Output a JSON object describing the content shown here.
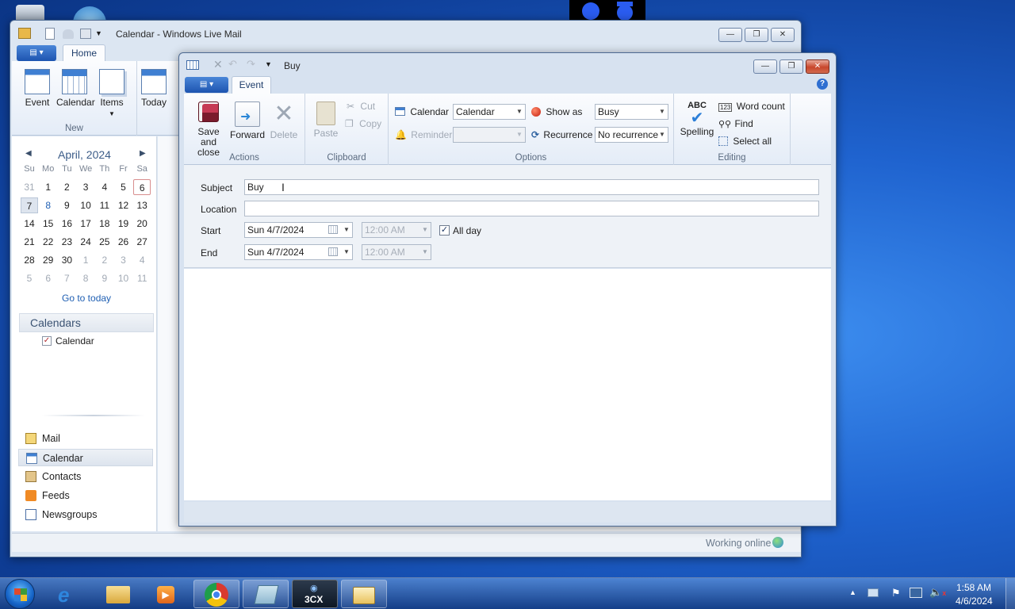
{
  "main_window": {
    "title": "Calendar - Windows Live Mail",
    "tab_home": "Home",
    "new_group": "New",
    "btn_event": "Event",
    "btn_calendar": "Calendar",
    "btn_items": "Items",
    "btn_today": "Today",
    "status": "Working online"
  },
  "mini_calendar": {
    "month": "April, 2024",
    "day_headers": [
      "Su",
      "Mo",
      "Tu",
      "We",
      "Th",
      "Fr",
      "Sa"
    ],
    "weeks": [
      [
        "31",
        "1",
        "2",
        "3",
        "4",
        "5",
        "6"
      ],
      [
        "7",
        "8",
        "9",
        "10",
        "11",
        "12",
        "13"
      ],
      [
        "14",
        "15",
        "16",
        "17",
        "18",
        "19",
        "20"
      ],
      [
        "21",
        "22",
        "23",
        "24",
        "25",
        "26",
        "27"
      ],
      [
        "28",
        "29",
        "30",
        "1",
        "2",
        "3",
        "4"
      ],
      [
        "5",
        "6",
        "7",
        "8",
        "9",
        "10",
        "11"
      ]
    ],
    "go_to_today": "Go to today"
  },
  "calendars_panel": {
    "header": "Calendars",
    "items": [
      "Calendar"
    ]
  },
  "nav": {
    "items": [
      "Mail",
      "Calendar",
      "Contacts",
      "Feeds",
      "Newsgroups"
    ]
  },
  "event_window": {
    "title": "Buy",
    "tab_event": "Event",
    "actions": {
      "save": "Save and close",
      "forward": "Forward",
      "delete": "Delete",
      "group": "Actions"
    },
    "clipboard": {
      "paste": "Paste",
      "cut": "Cut",
      "copy": "Copy",
      "group": "Clipboard"
    },
    "options": {
      "calendar_label": "Calendar",
      "calendar_value": "Calendar",
      "show_as_label": "Show as",
      "show_as_value": "Busy",
      "reminder_label": "Reminder",
      "reminder_value": "",
      "recurrence_label": "Recurrence",
      "recurrence_value": "No recurrence",
      "group": "Options"
    },
    "editing": {
      "spelling": "Spelling",
      "word_count": "Word count",
      "find": "Find",
      "select_all": "Select all",
      "group": "Editing"
    },
    "form": {
      "subject_label": "Subject",
      "subject_value": "Buy",
      "location_label": "Location",
      "location_value": "",
      "start_label": "Start",
      "start_date": "Sun 4/7/2024",
      "start_time": "12:00 AM",
      "end_label": "End",
      "end_date": "Sun 4/7/2024",
      "end_time": "12:00 AM",
      "all_day_label": "All day",
      "all_day_checked": true
    }
  },
  "taskbar": {
    "apps": [
      "start-orb",
      "internet-explorer",
      "file-explorer",
      "media-player",
      "chrome",
      "notepad",
      "3cx",
      "windows-live-mail"
    ],
    "label_3cx": "3CX",
    "time": "1:58 AM",
    "date": "4/6/2024"
  }
}
